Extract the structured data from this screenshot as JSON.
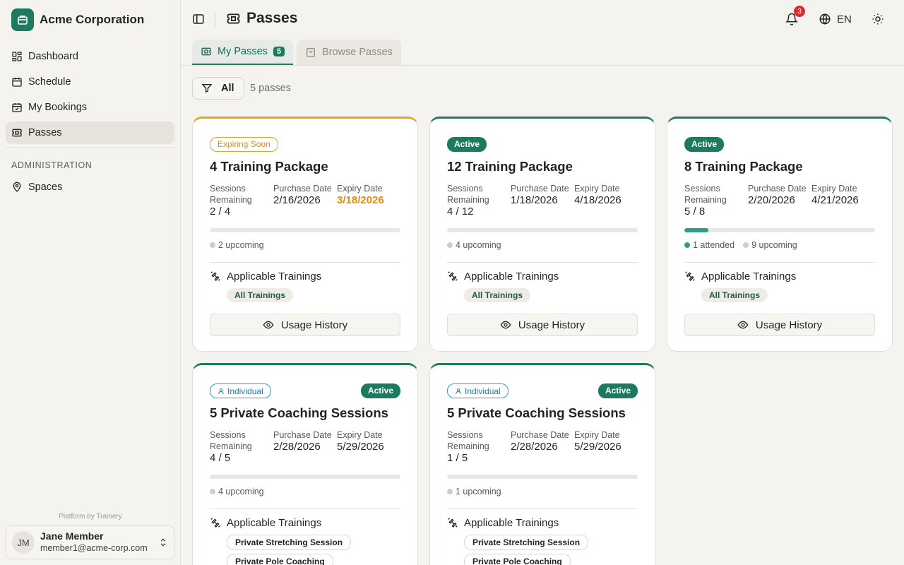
{
  "app": {
    "name": "Acme Corporation"
  },
  "sidebar": {
    "items": [
      {
        "label": "Dashboard",
        "icon": "dashboard-icon"
      },
      {
        "label": "Schedule",
        "icon": "calendar-icon"
      },
      {
        "label": "My Bookings",
        "icon": "calendar-check-icon"
      },
      {
        "label": "Passes",
        "icon": "ticket-icon",
        "active": true
      }
    ],
    "section_label": "ADMINISTRATION",
    "admin_items": [
      {
        "label": "Spaces",
        "icon": "map-pin-icon"
      }
    ],
    "platform_note": "Platform by Trainery"
  },
  "user": {
    "initials": "JM",
    "name": "Jane Member",
    "email": "member1@acme-corp.com"
  },
  "header": {
    "title": "Passes",
    "notification_count": "3",
    "language": "EN"
  },
  "tabs": [
    {
      "label": "My Passes",
      "count": "5",
      "active": true
    },
    {
      "label": "Browse Passes",
      "active": false
    }
  ],
  "filter": {
    "label": "All",
    "count_text": "5 passes"
  },
  "labels": {
    "sessions_remaining": "Sessions Remaining",
    "purchase_date": "Purchase Date",
    "expiry_date": "Expiry Date",
    "applicable_trainings": "Applicable Trainings",
    "usage_history": "Usage History"
  },
  "colors": {
    "accent": "#1d7a5f",
    "warning": "#eaa21e",
    "info": "#2a97c9",
    "danger": "#d92d2d"
  },
  "passes": [
    {
      "status": "Expiring Soon",
      "title": "4 Training Package",
      "sessions": "2 / 4",
      "purchase": "2/16/2026",
      "expiry": "3/18/2026",
      "upcoming": "2 upcoming",
      "attended": "",
      "progress": 0,
      "tags": [
        "All Trainings"
      ]
    },
    {
      "status": "Active",
      "title": "12 Training Package",
      "sessions": "4 / 12",
      "purchase": "1/18/2026",
      "expiry": "4/18/2026",
      "upcoming": "4 upcoming",
      "attended": "",
      "progress": 0,
      "tags": [
        "All Trainings"
      ]
    },
    {
      "status": "Active",
      "title": "8 Training Package",
      "sessions": "5 / 8",
      "purchase": "2/20/2026",
      "expiry": "4/21/2026",
      "upcoming": "9 upcoming",
      "attended": "1 attended",
      "progress": 0.125,
      "tags": [
        "All Trainings"
      ]
    },
    {
      "status": "Active",
      "type": "Individual",
      "title": "5 Private Coaching Sessions",
      "sessions": "4 / 5",
      "purchase": "2/28/2026",
      "expiry": "5/29/2026",
      "upcoming": "4 upcoming",
      "attended": "",
      "progress": 0,
      "tags": [
        "Private Stretching Session",
        "Private Pole Coaching"
      ]
    },
    {
      "status": "Active",
      "type": "Individual",
      "title": "5 Private Coaching Sessions",
      "sessions": "1 / 5",
      "purchase": "2/28/2026",
      "expiry": "5/29/2026",
      "upcoming": "1 upcoming",
      "attended": "",
      "progress": 0,
      "tags": [
        "Private Stretching Session",
        "Private Pole Coaching"
      ]
    }
  ]
}
